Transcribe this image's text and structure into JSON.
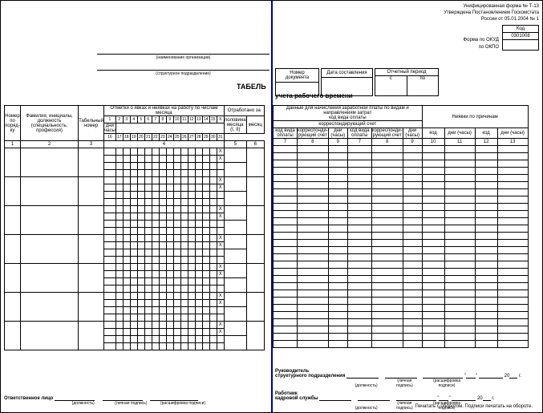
{
  "header": {
    "form_line1": "Унифицированная форма № Т-13",
    "form_line2": "Утверждена Постановлением Госкомстата",
    "form_line3": "России от 05.01.2004 № 1",
    "code_label": "Код",
    "okud_label": "Форма по ОКУД",
    "okud_value": "0301008",
    "okpo_label": "по ОКПО",
    "org_caption": "(наименование организации)",
    "dept_caption": "(структурное подразделение)"
  },
  "doc_info": {
    "num_label": "Номер документа",
    "date_label": "Дата составления",
    "period_label": "Отчетный период",
    "from": "с",
    "to": "по"
  },
  "title": "ТАБЕЛЬ",
  "subtitle": "учета рабочего времени",
  "cols": {
    "c1": "Номер по поряд-ку",
    "c2": "Фамилия, инициалы, должность (специальность, профессия)",
    "c3": "Табельный номер",
    "c4": "Отметки о явках и неявках на работу по числам месяца",
    "half": "половина месяца (I, II)",
    "month": "месяц",
    "days_hours": "дни часы",
    "c5": "Отработано за",
    "c6_title": "Данные для начисления заработной платы по видам и направлениям затрат",
    "c6_sub": "код вида оплаты",
    "c6_corr": "корреспондирующий счет",
    "c6_a": "код вида оплаты",
    "c6_b": "корреспонди-рующий счет",
    "c6_c": "дни (часы)",
    "c7": "Неявки по причинам",
    "c7_code": "код",
    "c7_days": "дни (часы)"
  },
  "days_r1": [
    "1",
    "2",
    "3",
    "4",
    "5",
    "6",
    "7",
    "8",
    "9",
    "10",
    "11",
    "12",
    "13",
    "14",
    "15",
    "X"
  ],
  "days_r2": [
    "16",
    "17",
    "18",
    "19",
    "20",
    "21",
    "22",
    "23",
    "24",
    "25",
    "26",
    "27",
    "28",
    "29",
    "30",
    "31"
  ],
  "col_nums_left": [
    "1",
    "2",
    "3",
    "4",
    "5",
    "6"
  ],
  "col_nums_right": [
    "7",
    "8",
    "9",
    "7",
    "8",
    "9",
    "10",
    "11",
    "12",
    "13"
  ],
  "sig": {
    "resp": "Ответственное лицо",
    "pos": "(должность)",
    "sign": "(личная подпись)",
    "trans": "(расшифровка подписи)",
    "head": "Руководитель",
    "head2": "структурного подразделения",
    "hr": "Работник",
    "hr2": "кадровой службы",
    "year": "20",
    "g": "г."
  },
  "footer": "Печатать с оборотом. Подписи печатать на обороте."
}
